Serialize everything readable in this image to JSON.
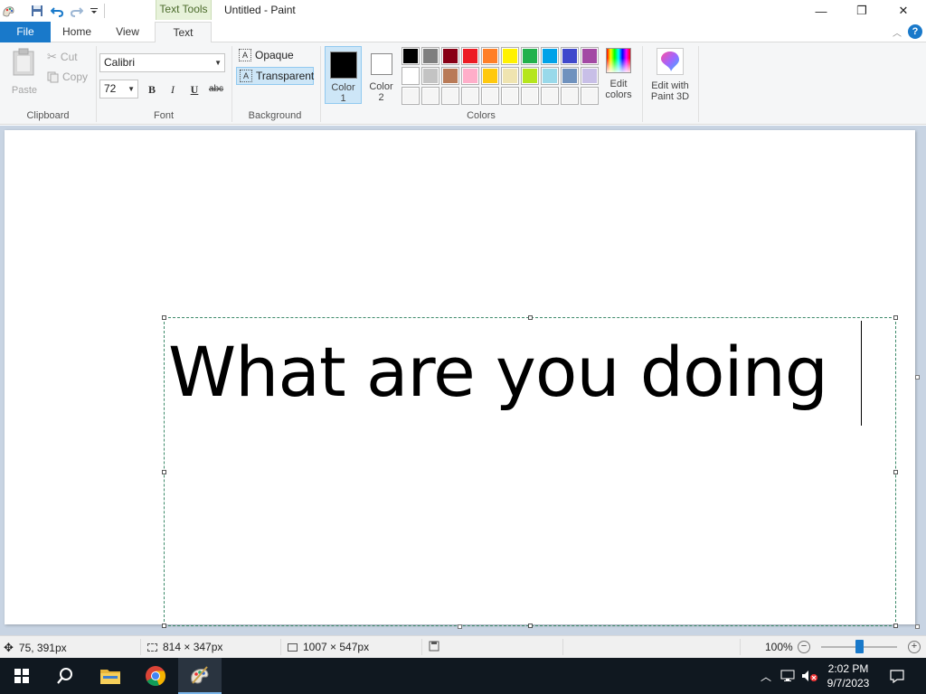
{
  "titlebar": {
    "context_tab": "Text Tools",
    "doc_title": "Untitled - Paint",
    "minimize": "—",
    "maximize": "❐",
    "close": "✕"
  },
  "tabs": {
    "file": "File",
    "home": "Home",
    "view": "View",
    "text": "Text"
  },
  "clipboard": {
    "paste": "Paste",
    "cut": "Cut",
    "copy": "Copy",
    "label": "Clipboard"
  },
  "font": {
    "family": "Calibri",
    "size": "72",
    "bold": "B",
    "italic": "I",
    "underline": "U",
    "strikethrough": "abc",
    "label": "Font"
  },
  "background": {
    "opaque": "Opaque",
    "transparent": "Transparent",
    "selected": "Transparent",
    "label": "Background"
  },
  "colors": {
    "color1_label": "Color\n1",
    "color2_label": "Color\n2",
    "color1": "#000000",
    "color2": "#ffffff",
    "edit_colors": "Edit\ncolors",
    "paint3d": "Edit with\nPaint 3D",
    "label": "Colors",
    "palette_row1": [
      "#000000",
      "#7f7f7f",
      "#880015",
      "#ed1c24",
      "#ff7f27",
      "#fff200",
      "#22b14c",
      "#00a2e8",
      "#3f48cc",
      "#a349a4"
    ],
    "palette_row2": [
      "#ffffff",
      "#c3c3c3",
      "#b97a57",
      "#ffaec9",
      "#ffc90e",
      "#efe4b0",
      "#b5e61d",
      "#99d9ea",
      "#7092be",
      "#c8bfe7"
    ],
    "palette_row3": [
      "#f5f5f5",
      "#f5f5f5",
      "#f5f5f5",
      "#f5f5f5",
      "#f5f5f5",
      "#f5f5f5",
      "#f5f5f5",
      "#f5f5f5",
      "#f5f5f5",
      "#f5f5f5"
    ]
  },
  "canvas": {
    "text": "What are you doing"
  },
  "status": {
    "cursor_pos": "75, 391px",
    "selection_size": "814 × 347px",
    "image_size": "1007 × 547px",
    "zoom": "100%",
    "zoom_level": 0.5
  },
  "taskbar": {
    "time": "2:02 PM",
    "date": "9/7/2023"
  }
}
